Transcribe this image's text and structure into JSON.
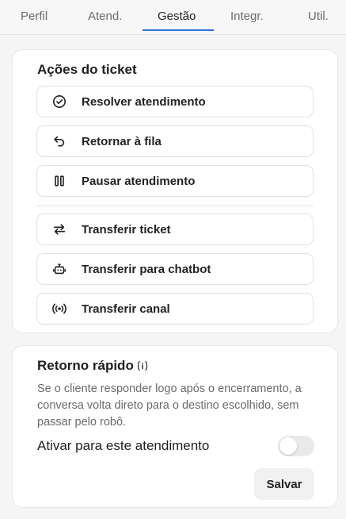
{
  "tabs": [
    {
      "label": "Perfil",
      "active": false
    },
    {
      "label": "Atend.",
      "active": false
    },
    {
      "label": "Gestão",
      "active": true
    },
    {
      "label": "Integr.",
      "active": false
    },
    {
      "label": "Util.",
      "active": false
    }
  ],
  "ticket_actions": {
    "title": "Ações do ticket",
    "buttons": [
      {
        "label": "Resolver atendimento",
        "icon": "check-circle-icon"
      },
      {
        "label": "Retornar à fila",
        "icon": "undo-arrow-icon"
      },
      {
        "label": "Pausar atendimento",
        "icon": "pause-icon"
      },
      {
        "label": "Transferir ticket",
        "icon": "swap-arrows-icon"
      },
      {
        "label": "Transferir para chatbot",
        "icon": "bot-icon"
      },
      {
        "label": "Transferir canal",
        "icon": "broadcast-icon"
      }
    ]
  },
  "quick_return": {
    "title": "Retorno rápido",
    "info_icon": "info-icon",
    "description": "Se o cliente responder logo após o encerramento, a conversa volta direto para o destino escolhido, sem passar pelo robô.",
    "toggle_label": "Ativar para este atendimento",
    "toggle_on": false,
    "save_label": "Salvar"
  },
  "colors": {
    "accent": "#2f6fde",
    "text": "#1f1f1f",
    "muted": "#6a6a6a",
    "background": "#f5f5f5",
    "card": "#ffffff",
    "border": "#e2e2e2"
  }
}
